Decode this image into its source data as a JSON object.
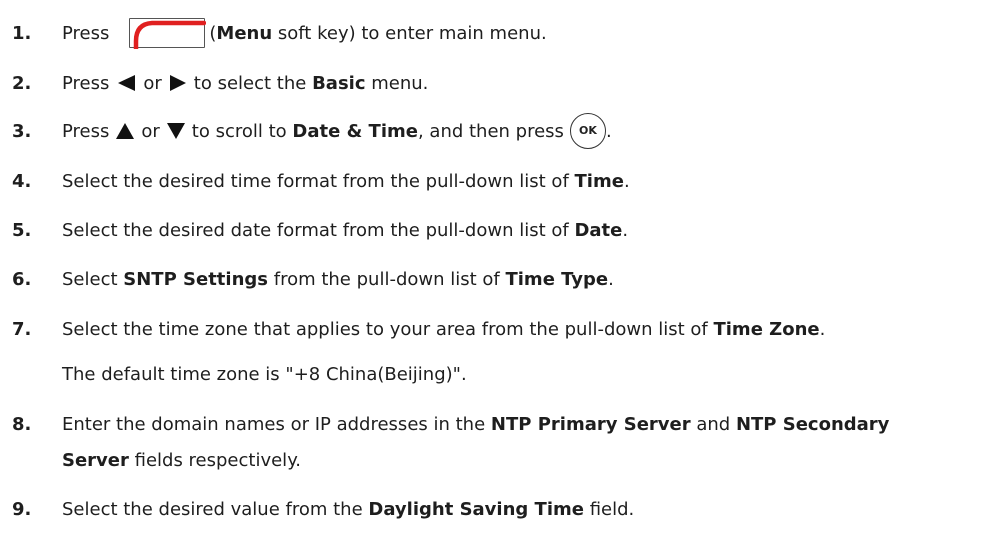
{
  "steps": [
    {
      "num": "1.",
      "t1": "Press",
      "b1": "Menu",
      "t2": "soft key) to enter main menu.",
      "paren": "("
    },
    {
      "num": "2.",
      "t1": "Press",
      "or": "or",
      "t2": "to select the",
      "b1": "Basic",
      "t3": "menu."
    },
    {
      "num": "3.",
      "t1": "Press",
      "or": "or",
      "t2": "to scroll to",
      "b1": "Date & Time",
      "t3": ", and then press",
      "ok": "OK",
      "t4": "."
    },
    {
      "num": "4.",
      "t1": "Select the desired time format from the pull-down list of",
      "b1": "Time",
      "t2": "."
    },
    {
      "num": "5.",
      "t1": "Select the desired date format from the pull-down list of",
      "b1": "Date",
      "t2": "."
    },
    {
      "num": "6.",
      "t1": "Select",
      "b1": "SNTP Settings",
      "t2": "from the pull-down list of",
      "b2": "Time Type",
      "t3": "."
    },
    {
      "num": "7.",
      "t1": "Select the time zone that applies to your area from the pull-down list of",
      "b1": "Time Zone",
      "t2": ".",
      "note": "The default time zone is \"+8 China(Beijing)\"."
    },
    {
      "num": "8.",
      "t1": "Enter the domain names or IP addresses in the",
      "b1": "NTP Primary Server",
      "t2": "and",
      "b2": "NTP Secondary",
      "b3": "Server",
      "t3": "fields respectively."
    },
    {
      "num": "9.",
      "t1": "Select the desired value from the",
      "b1": "Daylight Saving Time",
      "t2": "field."
    }
  ],
  "colors": {
    "softkey_accent": "#e02020",
    "text": "#1e1e1e"
  }
}
